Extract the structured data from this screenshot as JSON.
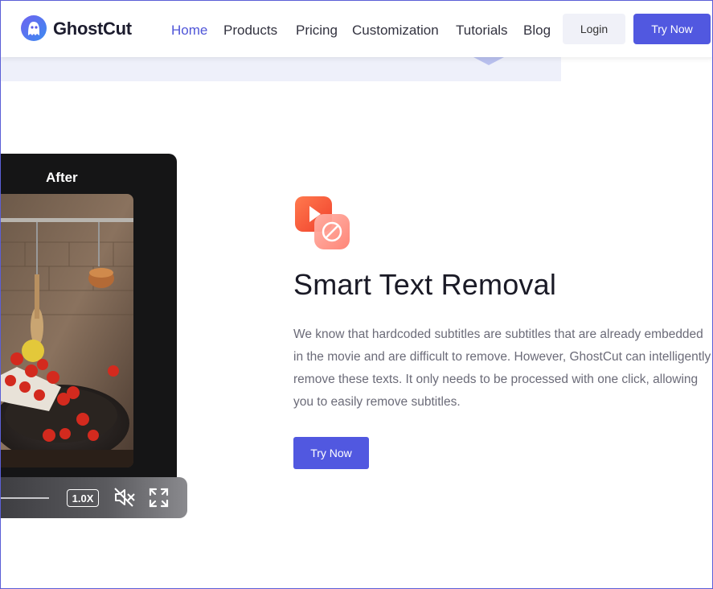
{
  "header": {
    "brand": "GhostCut",
    "nav": [
      {
        "label": "Home",
        "active": true
      },
      {
        "label": "Products",
        "active": false
      },
      {
        "label": "Pricing",
        "active": false
      },
      {
        "label": "Customization",
        "active": false
      },
      {
        "label": "Tutorials",
        "active": false
      },
      {
        "label": "Blog",
        "active": false
      }
    ],
    "login_label": "Login",
    "try_label": "Try Now"
  },
  "video": {
    "label": "After",
    "speed": "1.0X",
    "icons": [
      "mute-icon",
      "fullscreen-icon"
    ]
  },
  "feature": {
    "icon": "text-removal-icon",
    "title": "Smart Text Removal",
    "description": "We know that hardcoded subtitles are subtitles that are already embedded in the movie and are difficult to remove. However, GhostCut can intelligently remove these texts. It only needs to be processed with one click, allowing you to easily remove subtitles.",
    "cta_label": "Try Now"
  },
  "colors": {
    "accent": "#5158e0",
    "nav_active": "#4f55d8",
    "video_bg": "#151516"
  }
}
